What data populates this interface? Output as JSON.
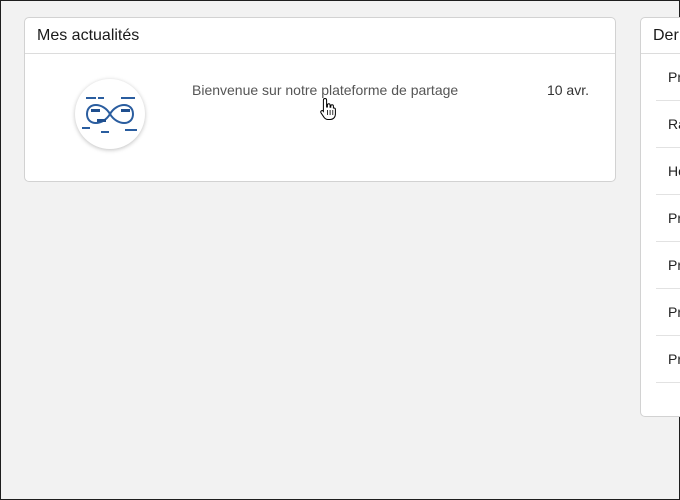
{
  "news": {
    "title": "Mes actualités",
    "items": [
      {
        "title": "Bienvenue sur notre plateforme de partage",
        "date": "10 avr.",
        "thumbnail_icon": "infinity-diagram-icon"
      }
    ]
  },
  "recent": {
    "title": "Der",
    "items": [
      {
        "label": "Pr"
      },
      {
        "label": "Ra"
      },
      {
        "label": "Ho"
      },
      {
        "label": "Pr"
      },
      {
        "label": "Pr"
      },
      {
        "label": "Pr"
      },
      {
        "label": "Pr"
      }
    ]
  },
  "colors": {
    "background": "#f2f2f2",
    "card": "#ffffff",
    "accent": "#2a5d9f"
  }
}
